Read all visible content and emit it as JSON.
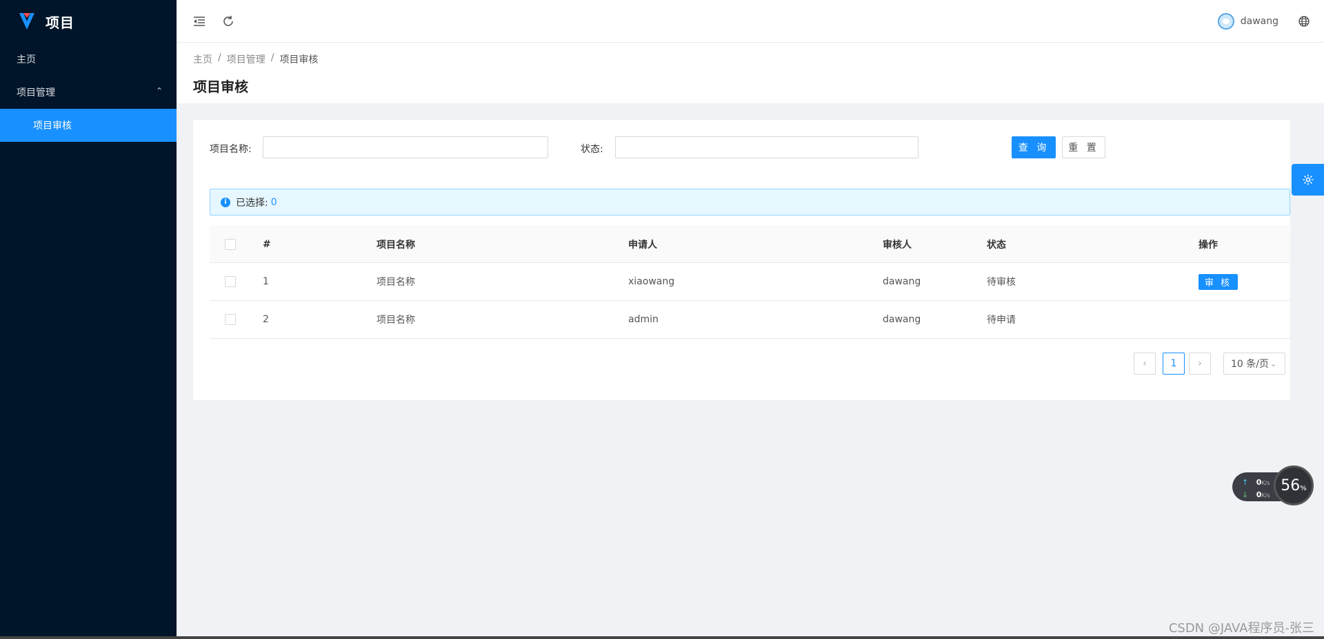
{
  "app": {
    "title": "项目"
  },
  "sidebar": {
    "items": [
      {
        "label": "主页"
      },
      {
        "label": "项目管理",
        "expanded": true
      },
      {
        "label": "项目审核",
        "active": true
      }
    ]
  },
  "header": {
    "username": "dawang"
  },
  "breadcrumb": [
    "主页",
    "项目管理",
    "项目审核"
  ],
  "page": {
    "title": "项目审核"
  },
  "filters": {
    "project_name_label": "项目名称:",
    "project_name_value": "",
    "status_label": "状态:",
    "status_value": "",
    "query_button": "查 询",
    "reset_button": "重 置"
  },
  "selection": {
    "label": "已选择:",
    "count": "0"
  },
  "table": {
    "columns": [
      "#",
      "项目名称",
      "申请人",
      "审核人",
      "状态",
      "操作"
    ],
    "rows": [
      {
        "index": "1",
        "name": "项目名称",
        "applicant": "xiaowang",
        "reviewer": "dawang",
        "status": "待审核",
        "action": "审 核"
      },
      {
        "index": "2",
        "name": "项目名称",
        "applicant": "admin",
        "reviewer": "dawang",
        "status": "待申请",
        "action": ""
      }
    ]
  },
  "pagination": {
    "current": "1",
    "page_size": "10 条/页"
  },
  "net_widget": {
    "up": "0",
    "down": "0",
    "unit": "K/s",
    "percent": "56",
    "percent_unit": "%"
  },
  "watermark": "CSDN @JAVA程序员-张三",
  "colors": {
    "primary": "#1890ff",
    "sider": "#001529"
  }
}
